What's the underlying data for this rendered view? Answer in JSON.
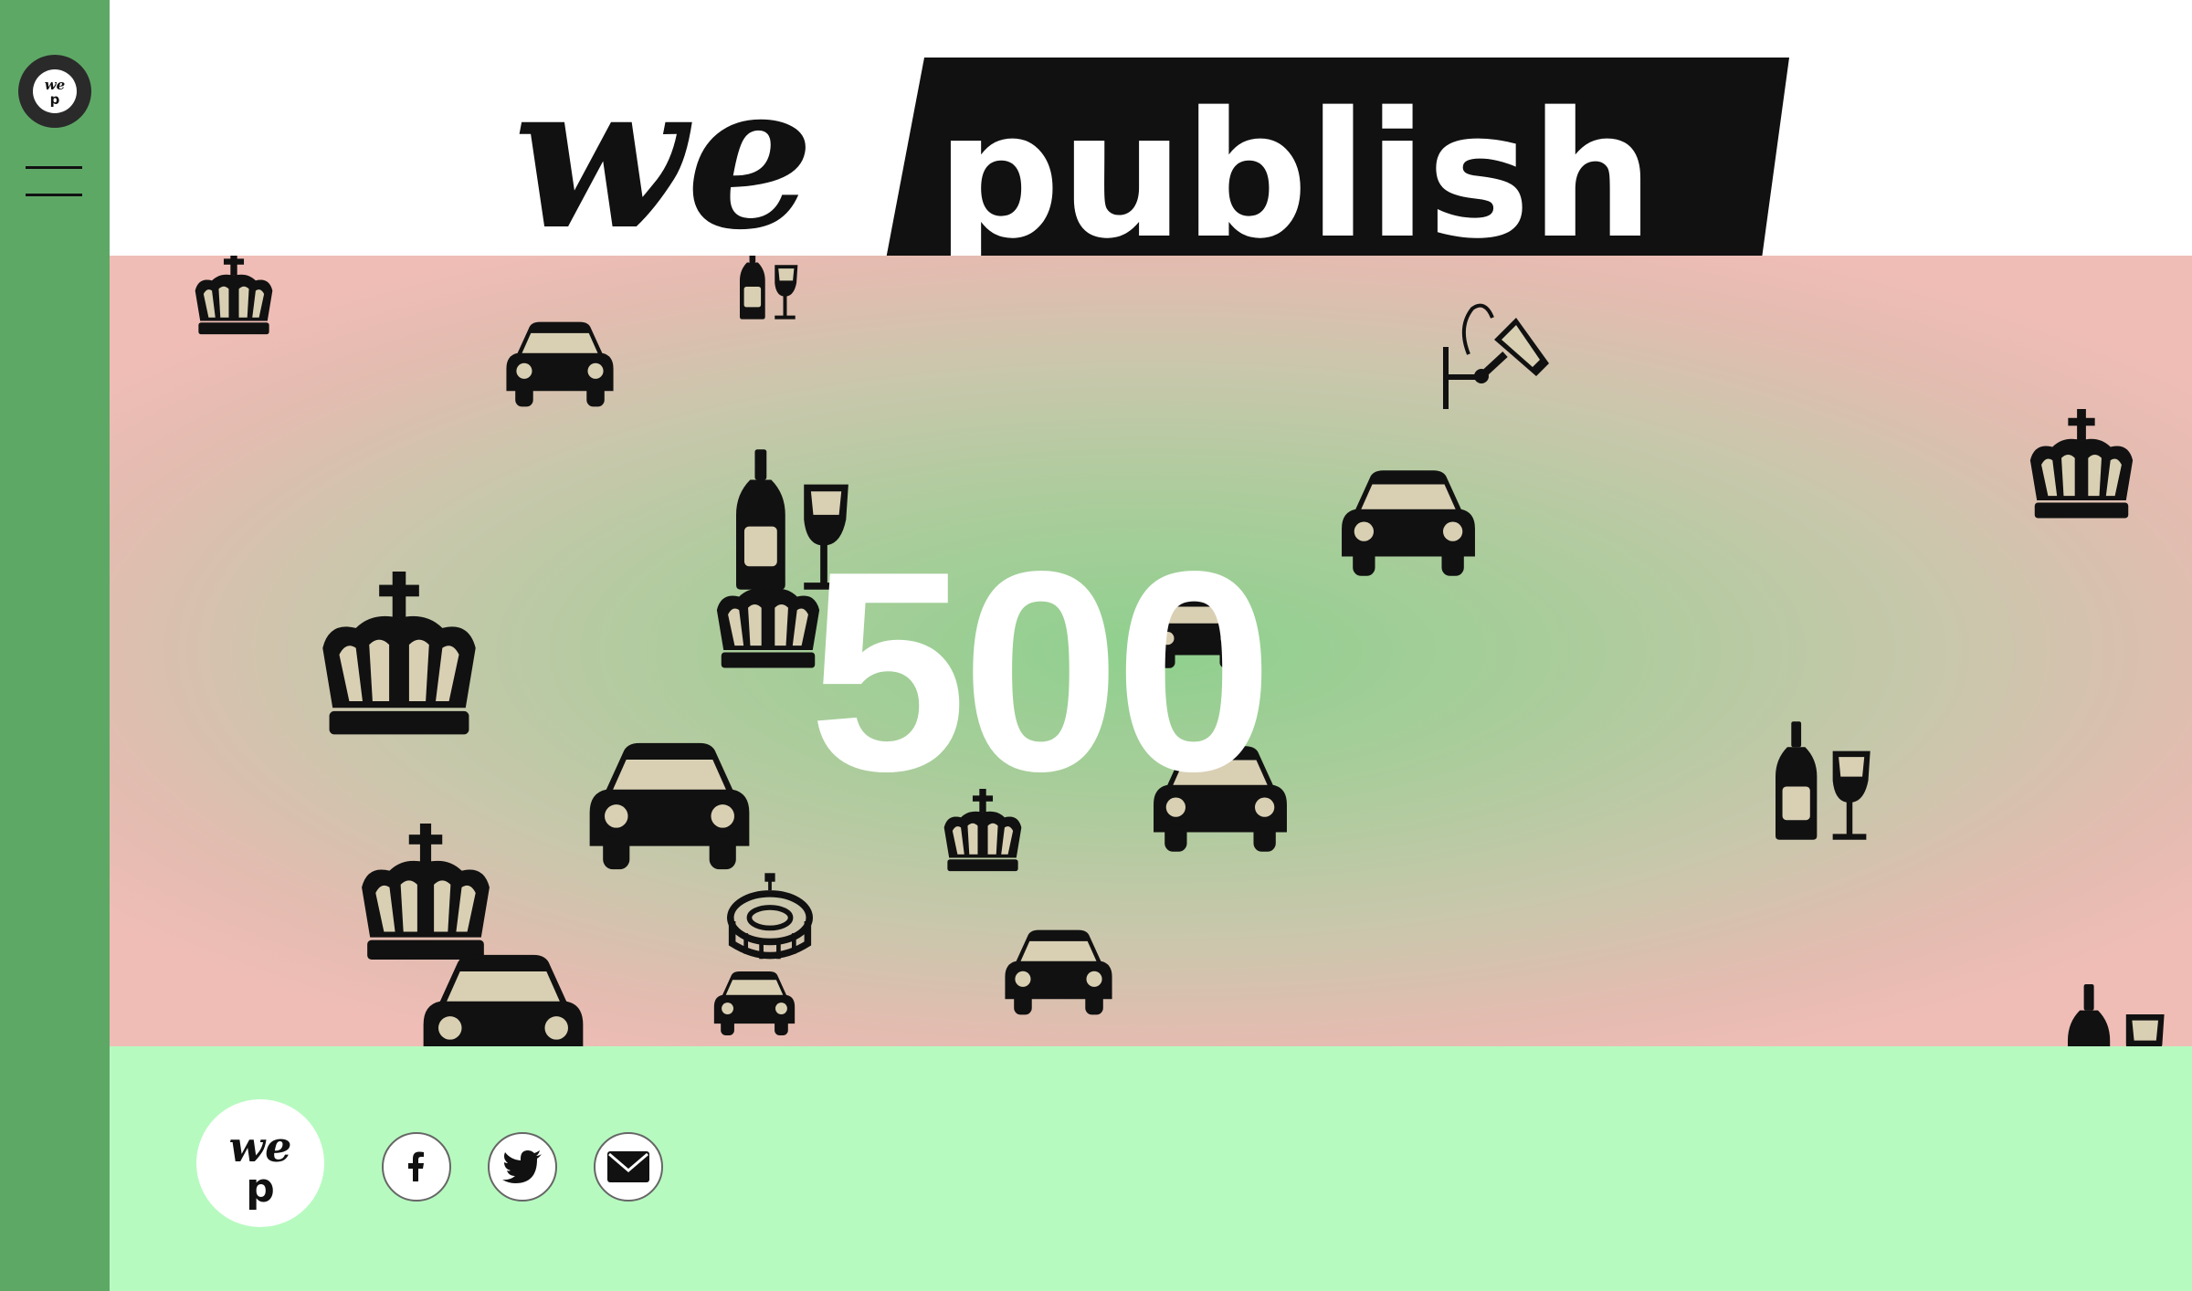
{
  "brand": {
    "logo_we": "we",
    "logo_publish": "publish",
    "badge_line1": "we",
    "badge_line2": "p"
  },
  "error": {
    "code": "500"
  },
  "sidebar": {
    "menu_icon": "hamburger-icon",
    "logo_icon": "wepublish-badge-icon"
  },
  "footer": {
    "share_icons": [
      "facebook-icon",
      "twitter-icon",
      "email-icon"
    ]
  },
  "colors": {
    "sidebar": "#5ea866",
    "footer": "#b7fac0",
    "hero_center": "#8fd08e",
    "hero_edge": "#efbdb6",
    "ink": "#111111",
    "white": "#ffffff"
  }
}
